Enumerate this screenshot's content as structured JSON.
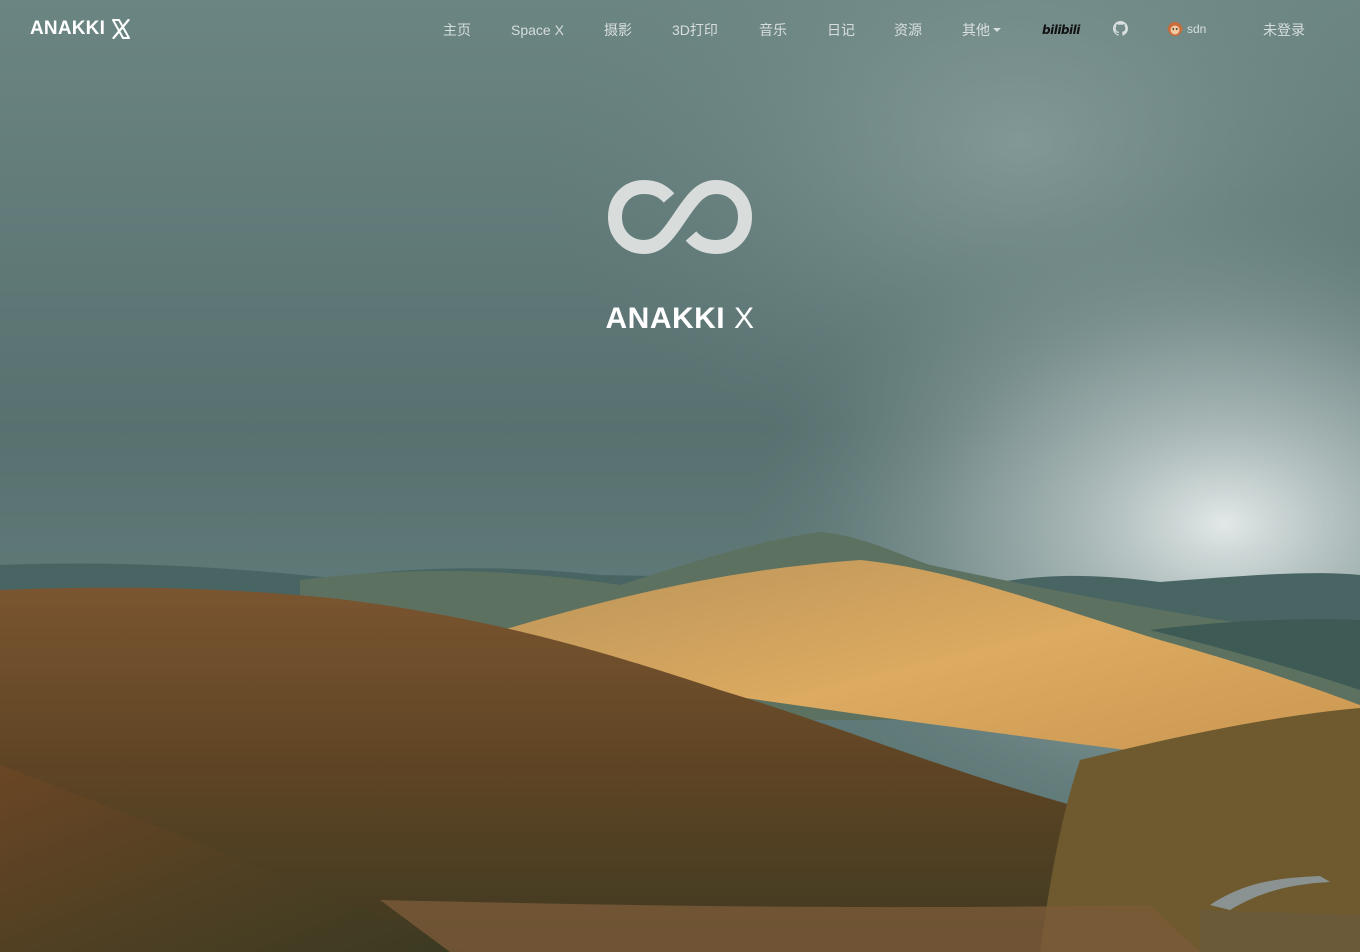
{
  "brand": {
    "name": "ANAKKI",
    "mark": "X"
  },
  "nav": {
    "items": [
      {
        "label": "主页"
      },
      {
        "label": "Space X"
      },
      {
        "label": "摄影"
      },
      {
        "label": "3D打印"
      },
      {
        "label": "音乐"
      },
      {
        "label": "日记"
      },
      {
        "label": "资源"
      },
      {
        "label": "其他"
      }
    ],
    "bilibili_label": "bilibili",
    "github_icon": "github-icon",
    "csdn_label": "sdn",
    "login_label": "未登录"
  },
  "hero": {
    "logo_icon": "infinity-icon",
    "title_main": "ANAKKI",
    "title_mark": "X",
    "background": "mountain landscape photo"
  },
  "colors": {
    "nav_text": "#c9d2d1",
    "sky": "#5e7776",
    "hills_gold": "#d7a55a",
    "hills_dark": "#5a3a1e"
  }
}
